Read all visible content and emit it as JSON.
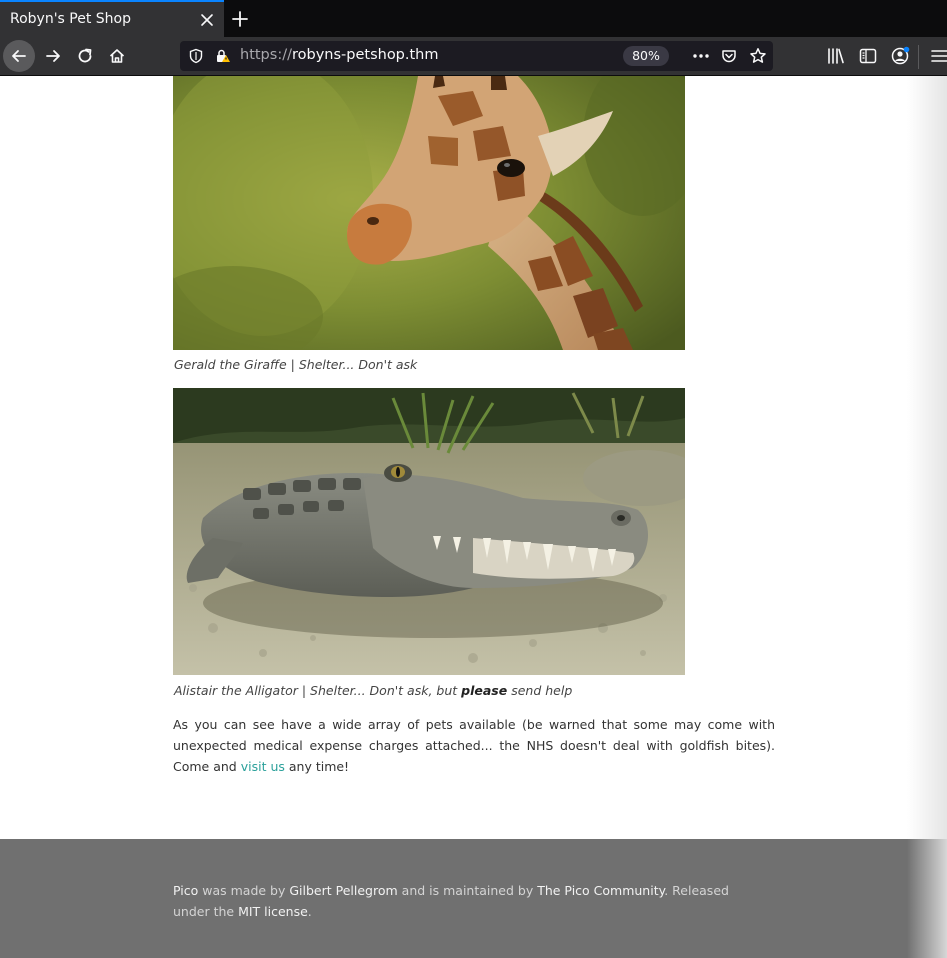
{
  "browser": {
    "tab_title": "Robyn's Pet Shop",
    "url_protocol": "https://",
    "url_host": "robyns-petshop.thm",
    "zoom": "80%",
    "accent": "#0a84ff"
  },
  "icons": {
    "tab_close": "close-icon",
    "new_tab": "plus-icon",
    "back": "back-arrow-icon",
    "forward": "forward-arrow-icon",
    "reload": "reload-icon",
    "home": "home-icon",
    "tracking": "shield-icon",
    "insecure": "warning-lock-icon",
    "page_actions": "more-dots-icon",
    "pocket": "pocket-icon",
    "bookmark": "star-icon",
    "library": "library-icon",
    "sidebar": "sidebar-icon",
    "account": "account-icon",
    "menu": "hamburger-menu-icon"
  },
  "content": {
    "caption_giraffe": "Gerald the Giraffe | Shelter... Don't ask",
    "caption_gator_prefix": "Alistair the Alligator | Shelter... Don't ask, but ",
    "caption_gator_bold": "please",
    "caption_gator_suffix": " send help",
    "paragraph_text": "As you can see have a wide array of pets available (be warned that some may come with unexpected medical expense charges attached... the NHS doesn't deal with goldfish bites). Come and ",
    "paragraph_link": "visit us",
    "paragraph_end": " any time!",
    "link_color": "#2aa09a"
  },
  "footer": {
    "pico_link": "Pico",
    "text1": " was made by ",
    "author_link": "Gilbert Pellegrom",
    "text2": " and is maintained by ",
    "community_link": "The Pico Community",
    "text3": ". Released under the ",
    "license_link": "MIT license",
    "text4": ".",
    "background": "#707070"
  }
}
